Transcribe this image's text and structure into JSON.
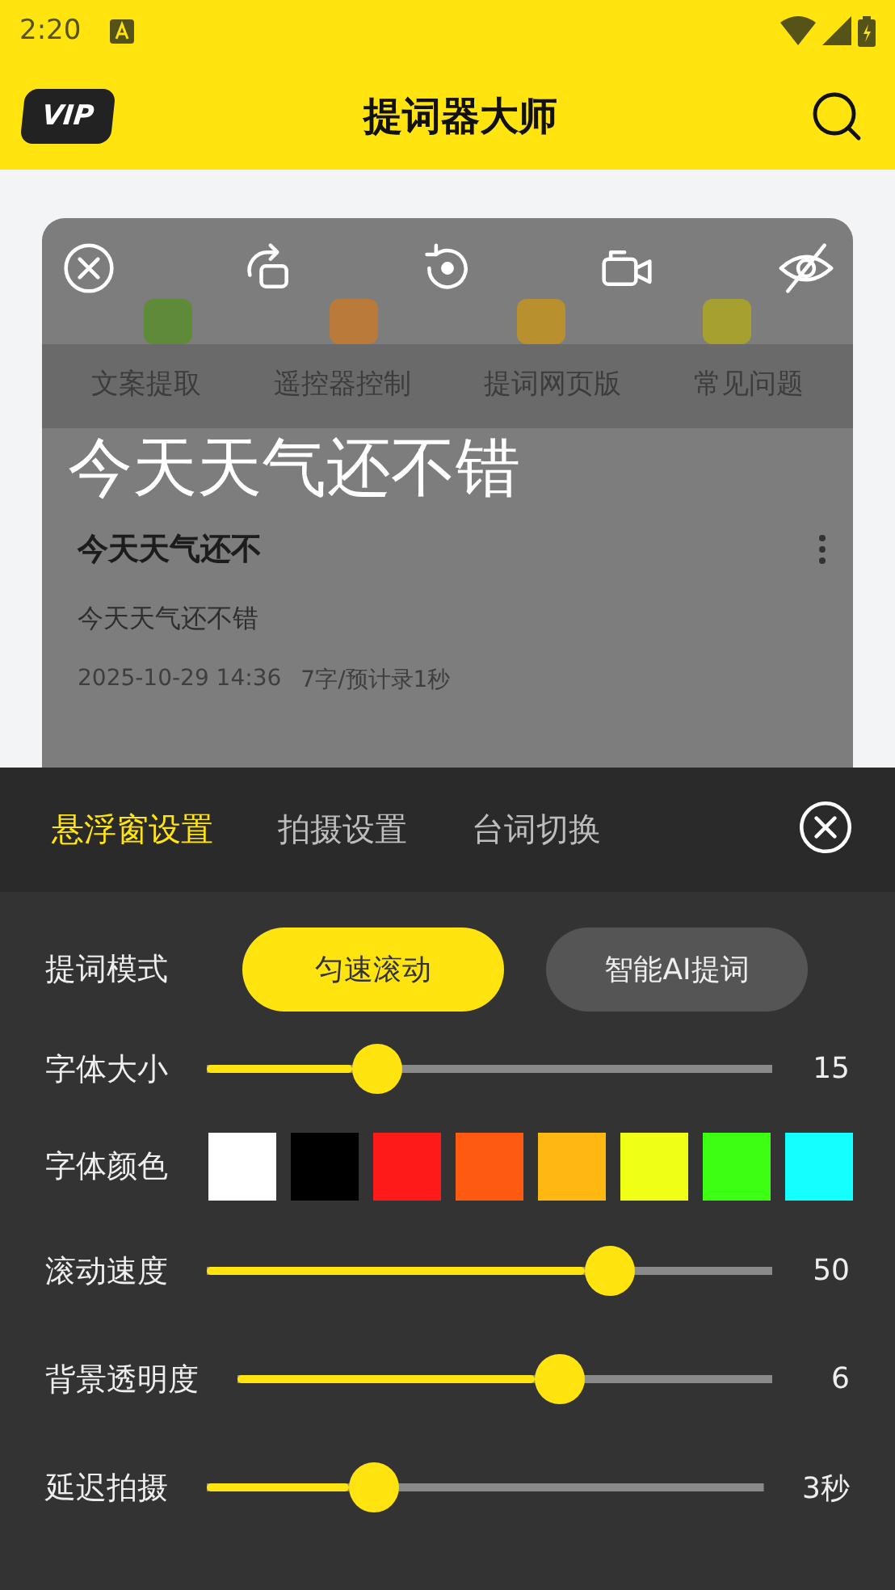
{
  "status_bar": {
    "time": "2:20"
  },
  "app_bar": {
    "vip_badge": "VIP",
    "title": "提词器大师"
  },
  "features": [
    {
      "label": "文案提取",
      "color": "#5f8a3a"
    },
    {
      "label": "遥控器控制",
      "color": "#b97a3a"
    },
    {
      "label": "提词网页版",
      "color": "#b8912e"
    },
    {
      "label": "常见问题",
      "color": "#a5a030"
    }
  ],
  "prompter_overlay": {
    "text": "今天天气还不错"
  },
  "script_item": {
    "title": "今天天气还不",
    "body": "今天天气还不错",
    "date": "2025-10-29 14:36",
    "stats": "7字/预计录1秒"
  },
  "settings_panel": {
    "tabs": [
      {
        "label": "悬浮窗设置",
        "selected": true
      },
      {
        "label": "拍摄设置",
        "selected": false
      },
      {
        "label": "台词切换",
        "selected": false
      }
    ],
    "mode": {
      "label": "提词模式",
      "options": [
        {
          "label": "匀速滚动",
          "selected": true
        },
        {
          "label": "智能AI提词",
          "selected": false
        }
      ]
    },
    "font_size": {
      "label": "字体大小",
      "level": 0.3,
      "reading": "15"
    },
    "font_color": {
      "label": "字体颜色",
      "swatches": [
        {
          "color": "#ffffff"
        },
        {
          "color": "#000000"
        },
        {
          "color": "#ff1a1a"
        },
        {
          "color": "#ff5a12"
        },
        {
          "color": "#ffb812"
        },
        {
          "color": "#f0ff16"
        },
        {
          "color": "#3cff14"
        },
        {
          "color": "#14ffff"
        }
      ]
    },
    "sliders": [
      {
        "label": "滚动速度",
        "level": 0.71,
        "reading": "50"
      },
      {
        "label": "背景透明度",
        "level": 0.6,
        "reading": "6"
      },
      {
        "label": "延迟拍摄",
        "level": 0.3,
        "reading": "3秒"
      }
    ]
  }
}
